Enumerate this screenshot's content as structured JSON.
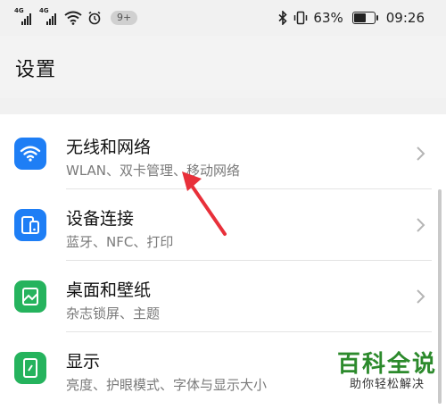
{
  "status_bar": {
    "sim1_tag": "4G",
    "sim2_tag": "4G",
    "notification_badge": "9+",
    "battery_percent": "63%",
    "battery_level": 0.63,
    "time": "09:26",
    "icons": [
      "signal-icon",
      "signal-icon",
      "wifi-icon",
      "alarm-icon",
      "bluetooth-icon",
      "vibrate-icon",
      "battery-icon"
    ]
  },
  "page": {
    "title": "设置"
  },
  "settings_items": [
    {
      "label": "无线和网络",
      "subtitle": "WLAN、双卡管理、移动网络",
      "icon": "wifi-icon",
      "color": "#1e7ef5"
    },
    {
      "label": "设备连接",
      "subtitle": "蓝牙、NFC、打印",
      "icon": "device-connect-icon",
      "color": "#1e7ef5"
    },
    {
      "label": "桌面和壁纸",
      "subtitle": "杂志锁屏、主题",
      "icon": "wallpaper-icon",
      "color": "#25b35d"
    },
    {
      "label": "显示",
      "subtitle": "亮度、护眼模式、字体与显示大小",
      "icon": "display-icon",
      "color": "#25b35d"
    }
  ],
  "watermark": {
    "title": "百科全说",
    "tagline": "助你轻松解决",
    "color": "#2c8a2c"
  },
  "annotation": {
    "color": "#e8303a"
  }
}
